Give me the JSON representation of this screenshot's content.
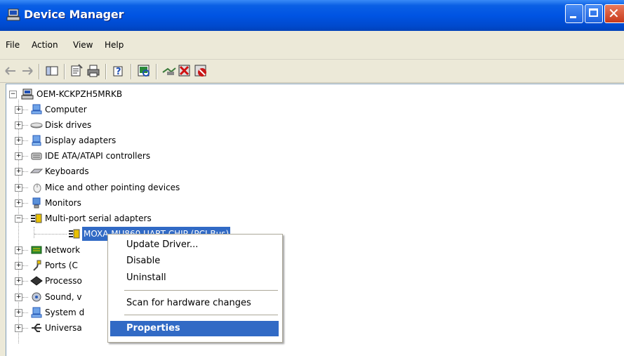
{
  "window": {
    "title": "Device Manager"
  },
  "menubar": {
    "items": [
      "File",
      "Action",
      "View",
      "Help"
    ]
  },
  "toolbar": {
    "buttons": [
      "back-icon",
      "forward-icon",
      "show-hide-console-tree-icon",
      "properties-icon",
      "print-icon",
      "help-icon",
      "scan-hardware-icon",
      "update-driver-icon",
      "uninstall-icon",
      "disable-icon"
    ]
  },
  "tree": {
    "root": "OEM-KCKPZH5MRKB",
    "nodes": [
      {
        "label": "Computer",
        "icon": "computer-icon",
        "expander": "+"
      },
      {
        "label": "Disk drives",
        "icon": "disk-drive-icon",
        "expander": "+"
      },
      {
        "label": "Display adapters",
        "icon": "display-adapter-icon",
        "expander": "+"
      },
      {
        "label": "IDE ATA/ATAPI controllers",
        "icon": "ide-controller-icon",
        "expander": "+"
      },
      {
        "label": "Keyboards",
        "icon": "keyboard-icon",
        "expander": "+"
      },
      {
        "label": "Mice and other pointing devices",
        "icon": "mouse-icon",
        "expander": "+"
      },
      {
        "label": "Monitors",
        "icon": "monitor-icon",
        "expander": "+"
      },
      {
        "label": "Multi-port serial adapters",
        "icon": "serial-adapter-icon",
        "expander": "−"
      },
      {
        "label": "Network",
        "icon": "network-adapter-icon",
        "expander": "+"
      },
      {
        "label": "Ports (C",
        "icon": "ports-icon",
        "expander": "+"
      },
      {
        "label": "Processo",
        "icon": "processor-icon",
        "expander": "+"
      },
      {
        "label": "Sound, v",
        "icon": "sound-icon",
        "expander": "+"
      },
      {
        "label": "System d",
        "icon": "system-devices-icon",
        "expander": "+"
      },
      {
        "label": "Universa",
        "icon": "usb-icon",
        "expander": "+"
      }
    ],
    "child": {
      "label": "MOXA MU860 UART CHIP (PCI Bus)",
      "icon": "serial-adapter-icon"
    }
  },
  "context_menu": {
    "items": [
      "Update Driver...",
      "Disable",
      "Uninstall",
      "Scan for hardware changes",
      "Properties"
    ]
  },
  "colors": {
    "selection": "#316AC5",
    "titlebar": "#0054E3",
    "window_bg": "#ECE9D8"
  }
}
